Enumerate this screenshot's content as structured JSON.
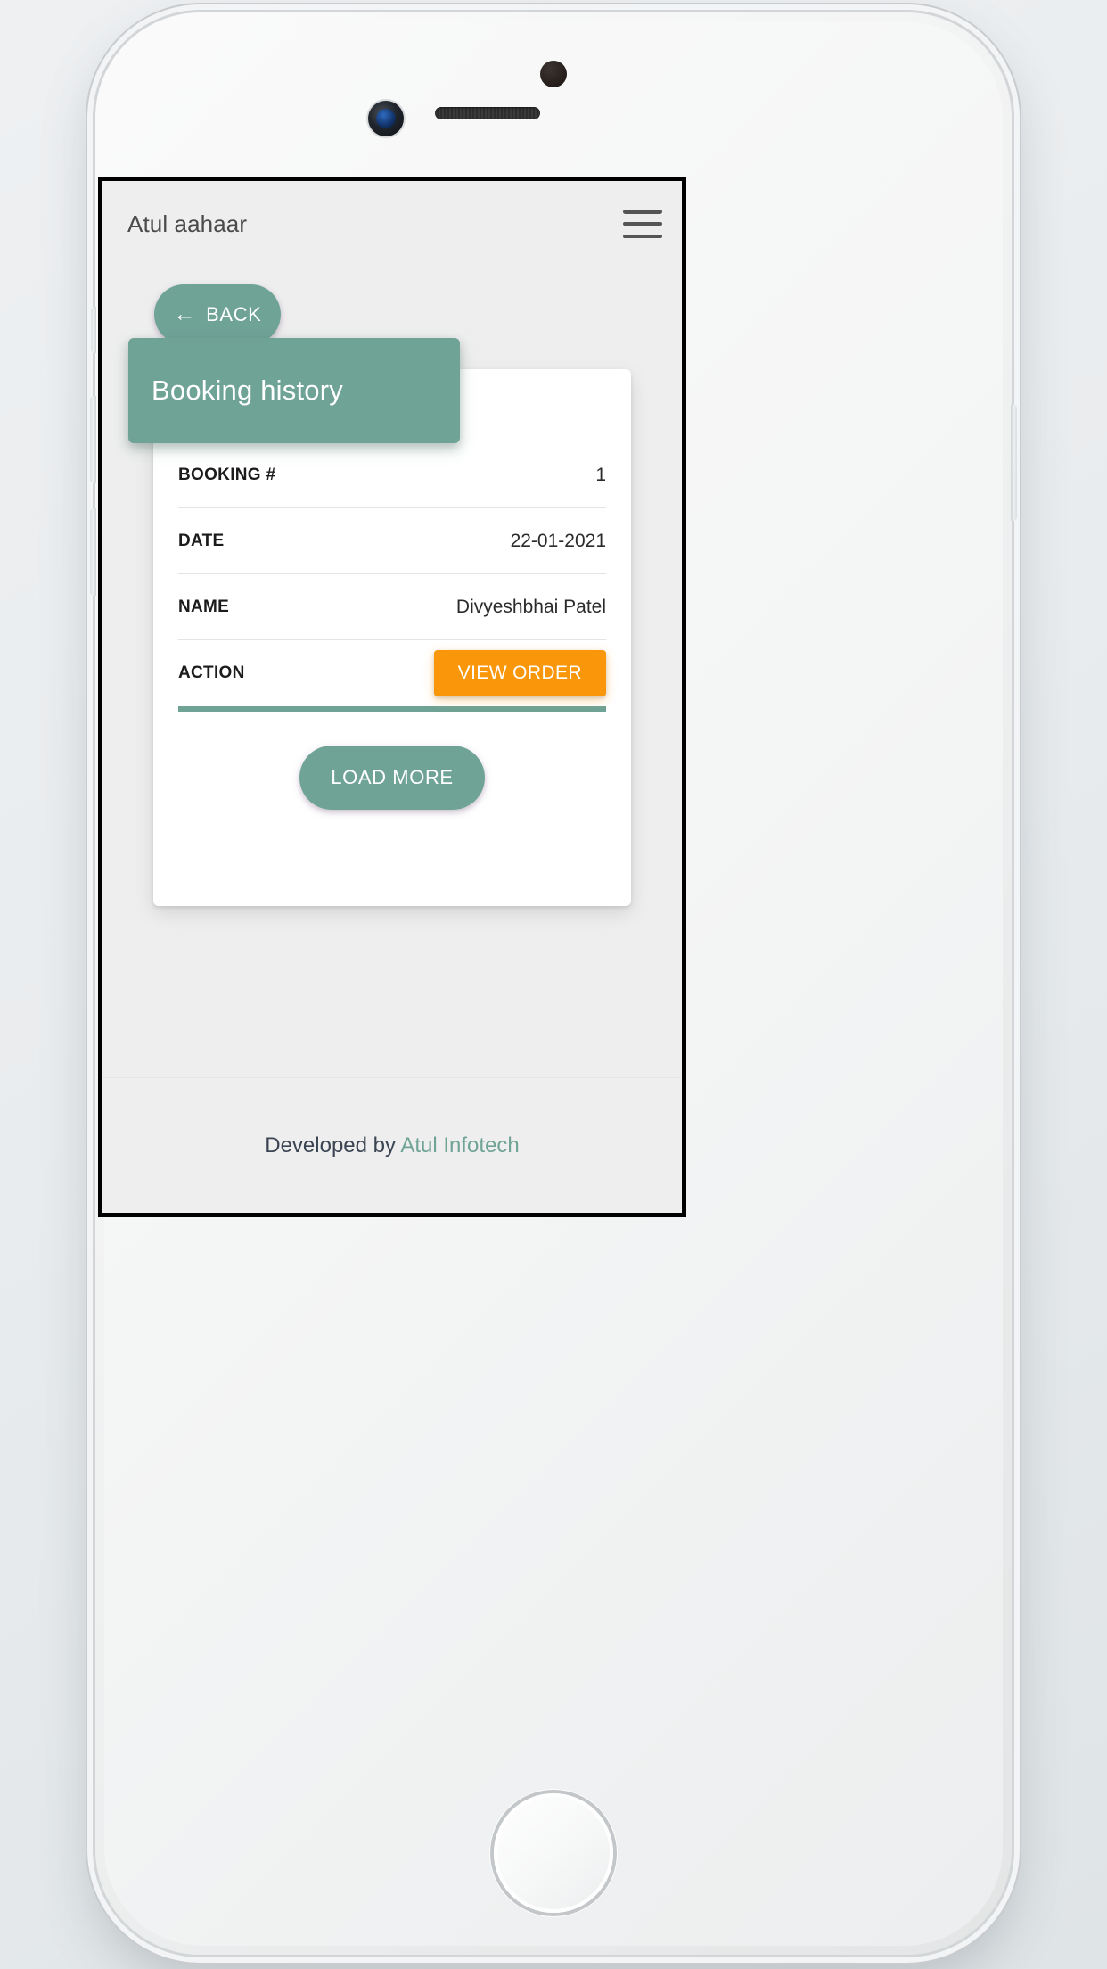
{
  "colors": {
    "brand_green": "#6fa396",
    "accent_orange": "#fa9609",
    "screen_bg": "#eeeeee",
    "card_bg": "#ffffff",
    "app_title_text": "#4a4a4a"
  },
  "app_bar": {
    "title": "Atul aahaar",
    "menu_icon": "hamburger-menu-icon"
  },
  "back_button": {
    "label": "BACK",
    "icon": "arrow-left-icon",
    "arrow_glyph": "←"
  },
  "card": {
    "header_title": "Booking history",
    "rows": [
      {
        "label": "BOOKING #",
        "value": "1",
        "type": "text"
      },
      {
        "label": "DATE",
        "value": "22-01-2021",
        "type": "text"
      },
      {
        "label": "NAME",
        "value": "Divyeshbhai Patel",
        "type": "text"
      },
      {
        "label": "ACTION",
        "value": "VIEW ORDER",
        "type": "button"
      }
    ],
    "load_more_label": "LOAD MORE"
  },
  "footer": {
    "prefix": "Developed by ",
    "brand": "Atul Infotech"
  },
  "device": {
    "type": "smartphone-mockup",
    "sensor": "proximity-sensor",
    "camera": "front-camera",
    "speaker": "earpiece-speaker",
    "home": "home-button"
  }
}
